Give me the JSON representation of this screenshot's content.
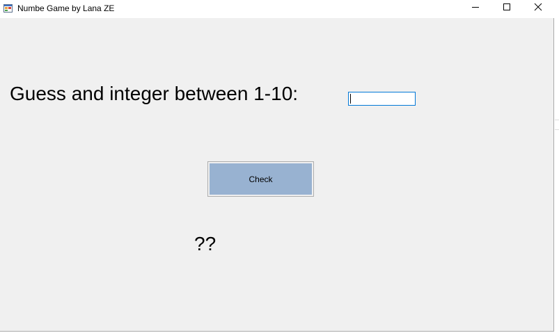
{
  "window": {
    "title": "Numbe Game by Lana ZE",
    "app_icon": "windows-form-icon",
    "controls": {
      "minimize_icon": "minimize-icon",
      "maximize_icon": "maximize-icon",
      "close_icon": "close-icon"
    }
  },
  "form": {
    "prompt": "Guess and integer between 1-10:",
    "guess_input": {
      "value": "",
      "placeholder": ""
    },
    "check_button": {
      "label": "Check",
      "color": "#98b2d1"
    },
    "result": "??"
  },
  "colors": {
    "form_background": "#f0f0f0",
    "input_focus_border": "#0078d7"
  }
}
